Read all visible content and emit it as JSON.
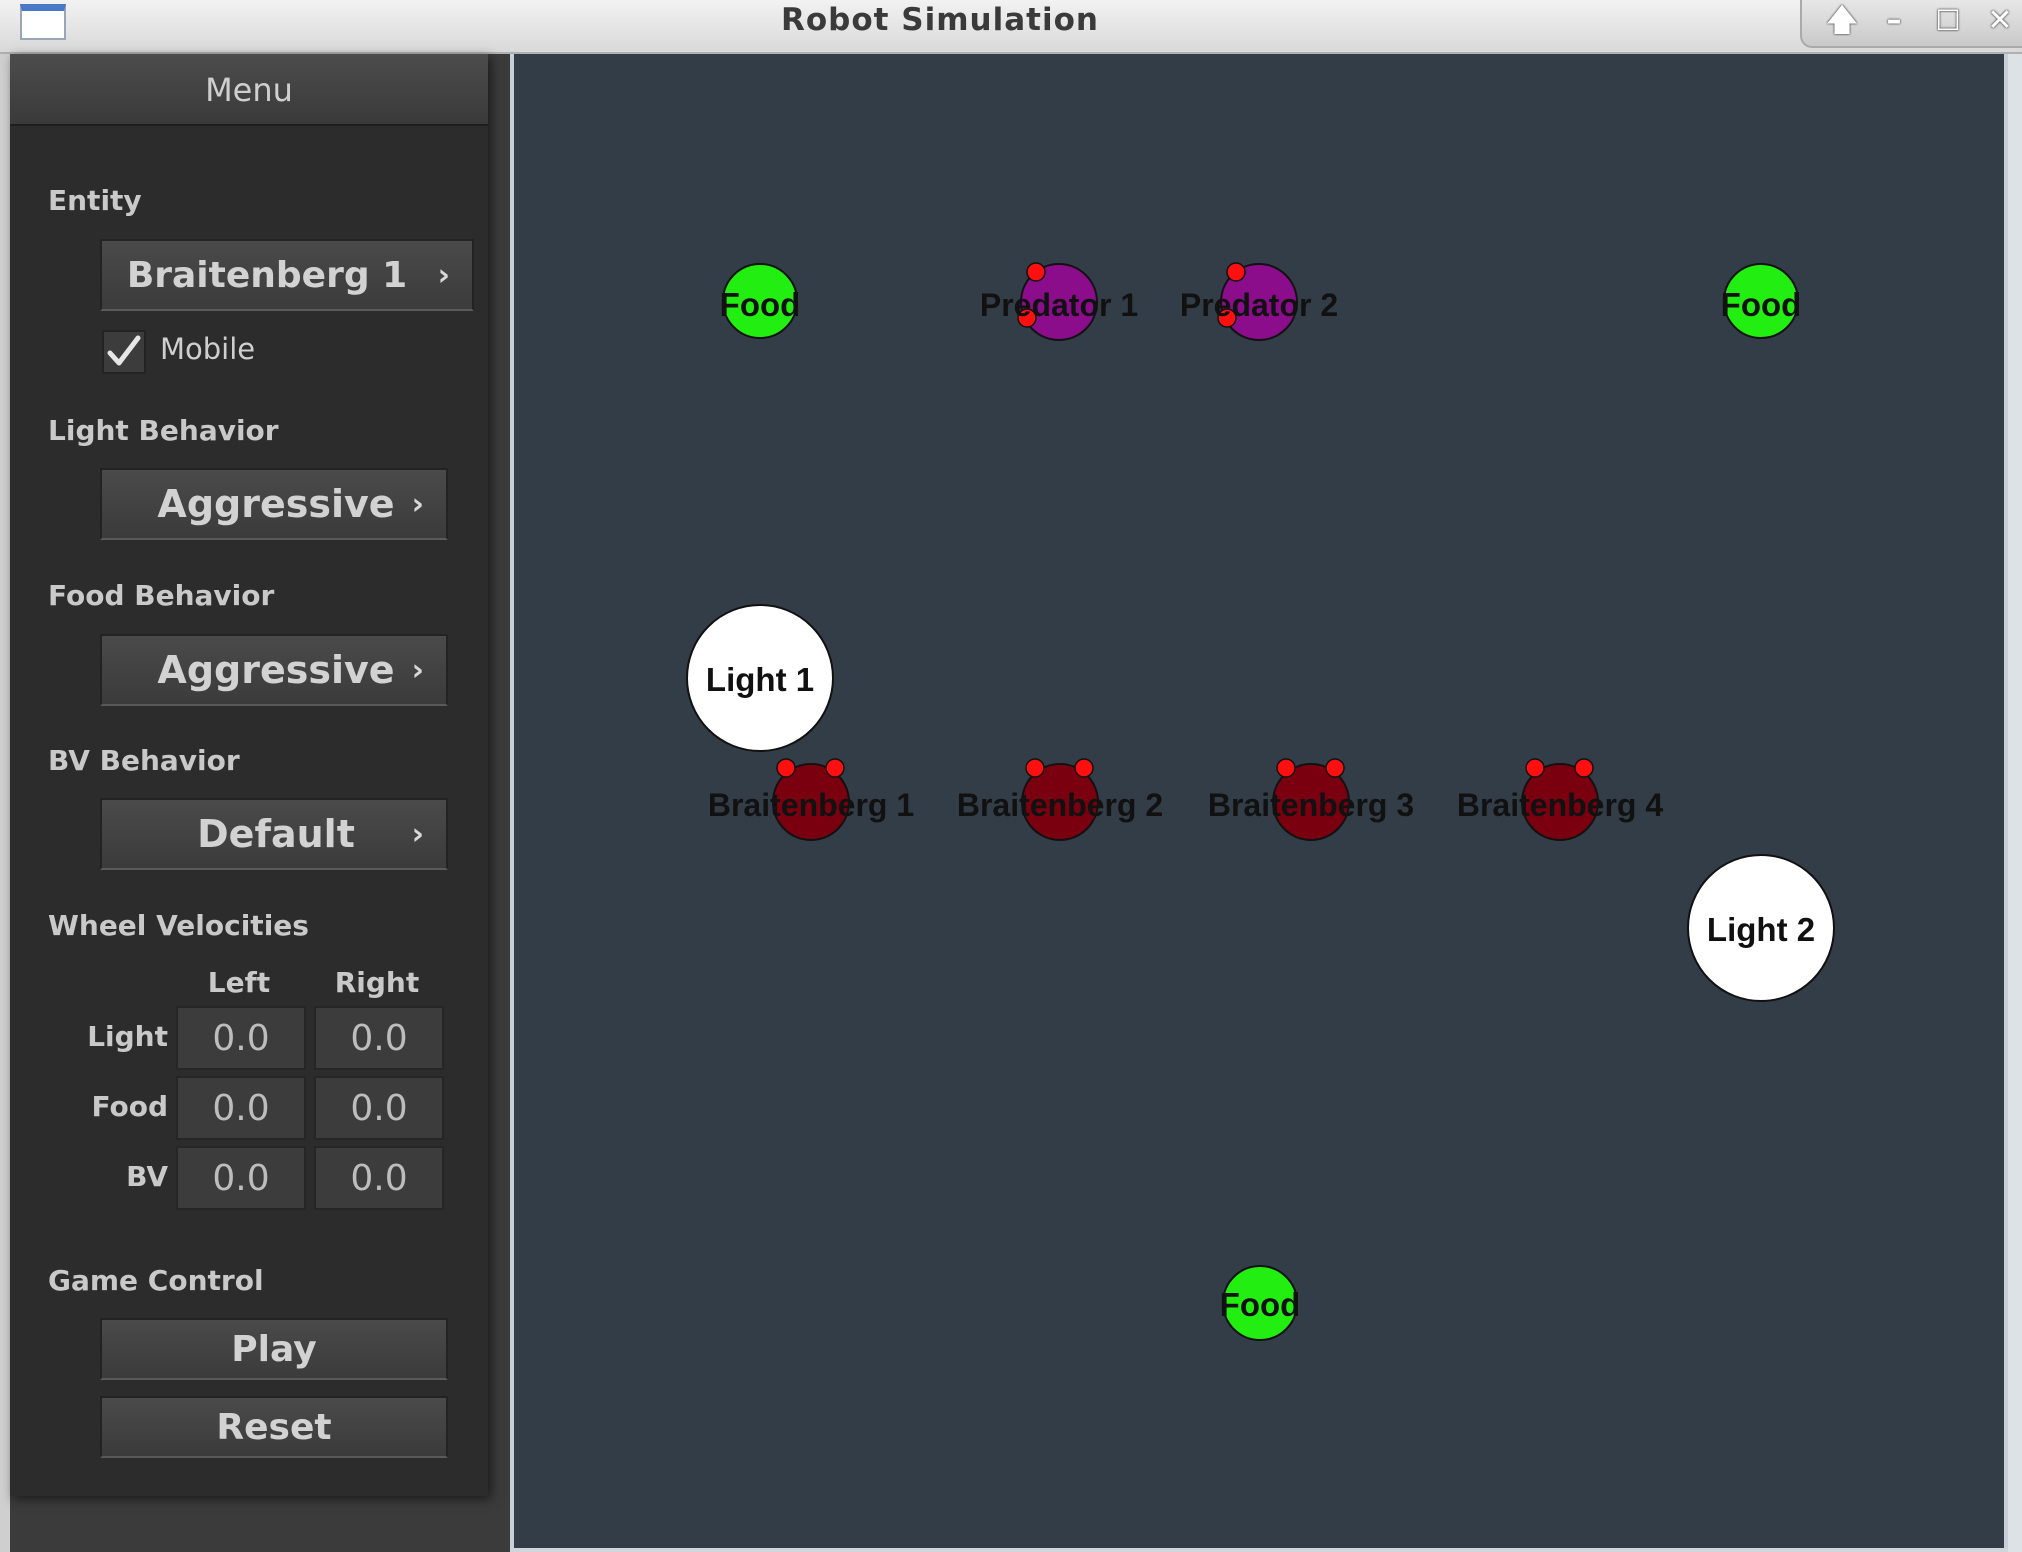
{
  "window": {
    "title": "Robot Simulation",
    "controls": [
      "🡅",
      "–",
      "☐",
      "✕"
    ]
  },
  "menu": {
    "title": "Menu",
    "entity_label": "Entity",
    "entity_value": "Braitenberg 1",
    "mobile_label": "Mobile",
    "mobile_checked": true,
    "light_behavior_label": "Light Behavior",
    "light_behavior_value": "Aggressive",
    "food_behavior_label": "Food Behavior",
    "food_behavior_value": "Aggressive",
    "bv_behavior_label": "BV Behavior",
    "bv_behavior_value": "Default",
    "wheel_velocities_label": "Wheel Velocities",
    "velocity_columns": [
      "Left",
      "Right"
    ],
    "velocity_rows": [
      {
        "label": "Light",
        "left": "0.0",
        "right": "0.0"
      },
      {
        "label": "Food",
        "left": "0.0",
        "right": "0.0"
      },
      {
        "label": "BV",
        "left": "0.0",
        "right": "0.0"
      }
    ],
    "game_control_label": "Game Control",
    "play_label": "Play",
    "reset_label": "Reset",
    "chevron": "›"
  },
  "arena": {
    "colors": {
      "background": "#333d48",
      "food": "#22ee11",
      "predator": "#8b0d8b",
      "braitenberg": "#7a0010",
      "sensor": "#ff1010",
      "light": "#ffffff"
    },
    "entities": [
      {
        "kind": "food",
        "label": "Food"
      },
      {
        "kind": "predator",
        "label": "Predator 1"
      },
      {
        "kind": "predator",
        "label": "Predator 2"
      },
      {
        "kind": "food",
        "label": "Food"
      },
      {
        "kind": "light",
        "label": "Light 1"
      },
      {
        "kind": "braitenberg",
        "label": "Braitenberg 1"
      },
      {
        "kind": "braitenberg",
        "label": "Braitenberg 2"
      },
      {
        "kind": "braitenberg",
        "label": "Braitenberg 3"
      },
      {
        "kind": "braitenberg",
        "label": "Braitenberg 4"
      },
      {
        "kind": "light",
        "label": "Light 2"
      },
      {
        "kind": "food",
        "label": "Food"
      }
    ]
  }
}
